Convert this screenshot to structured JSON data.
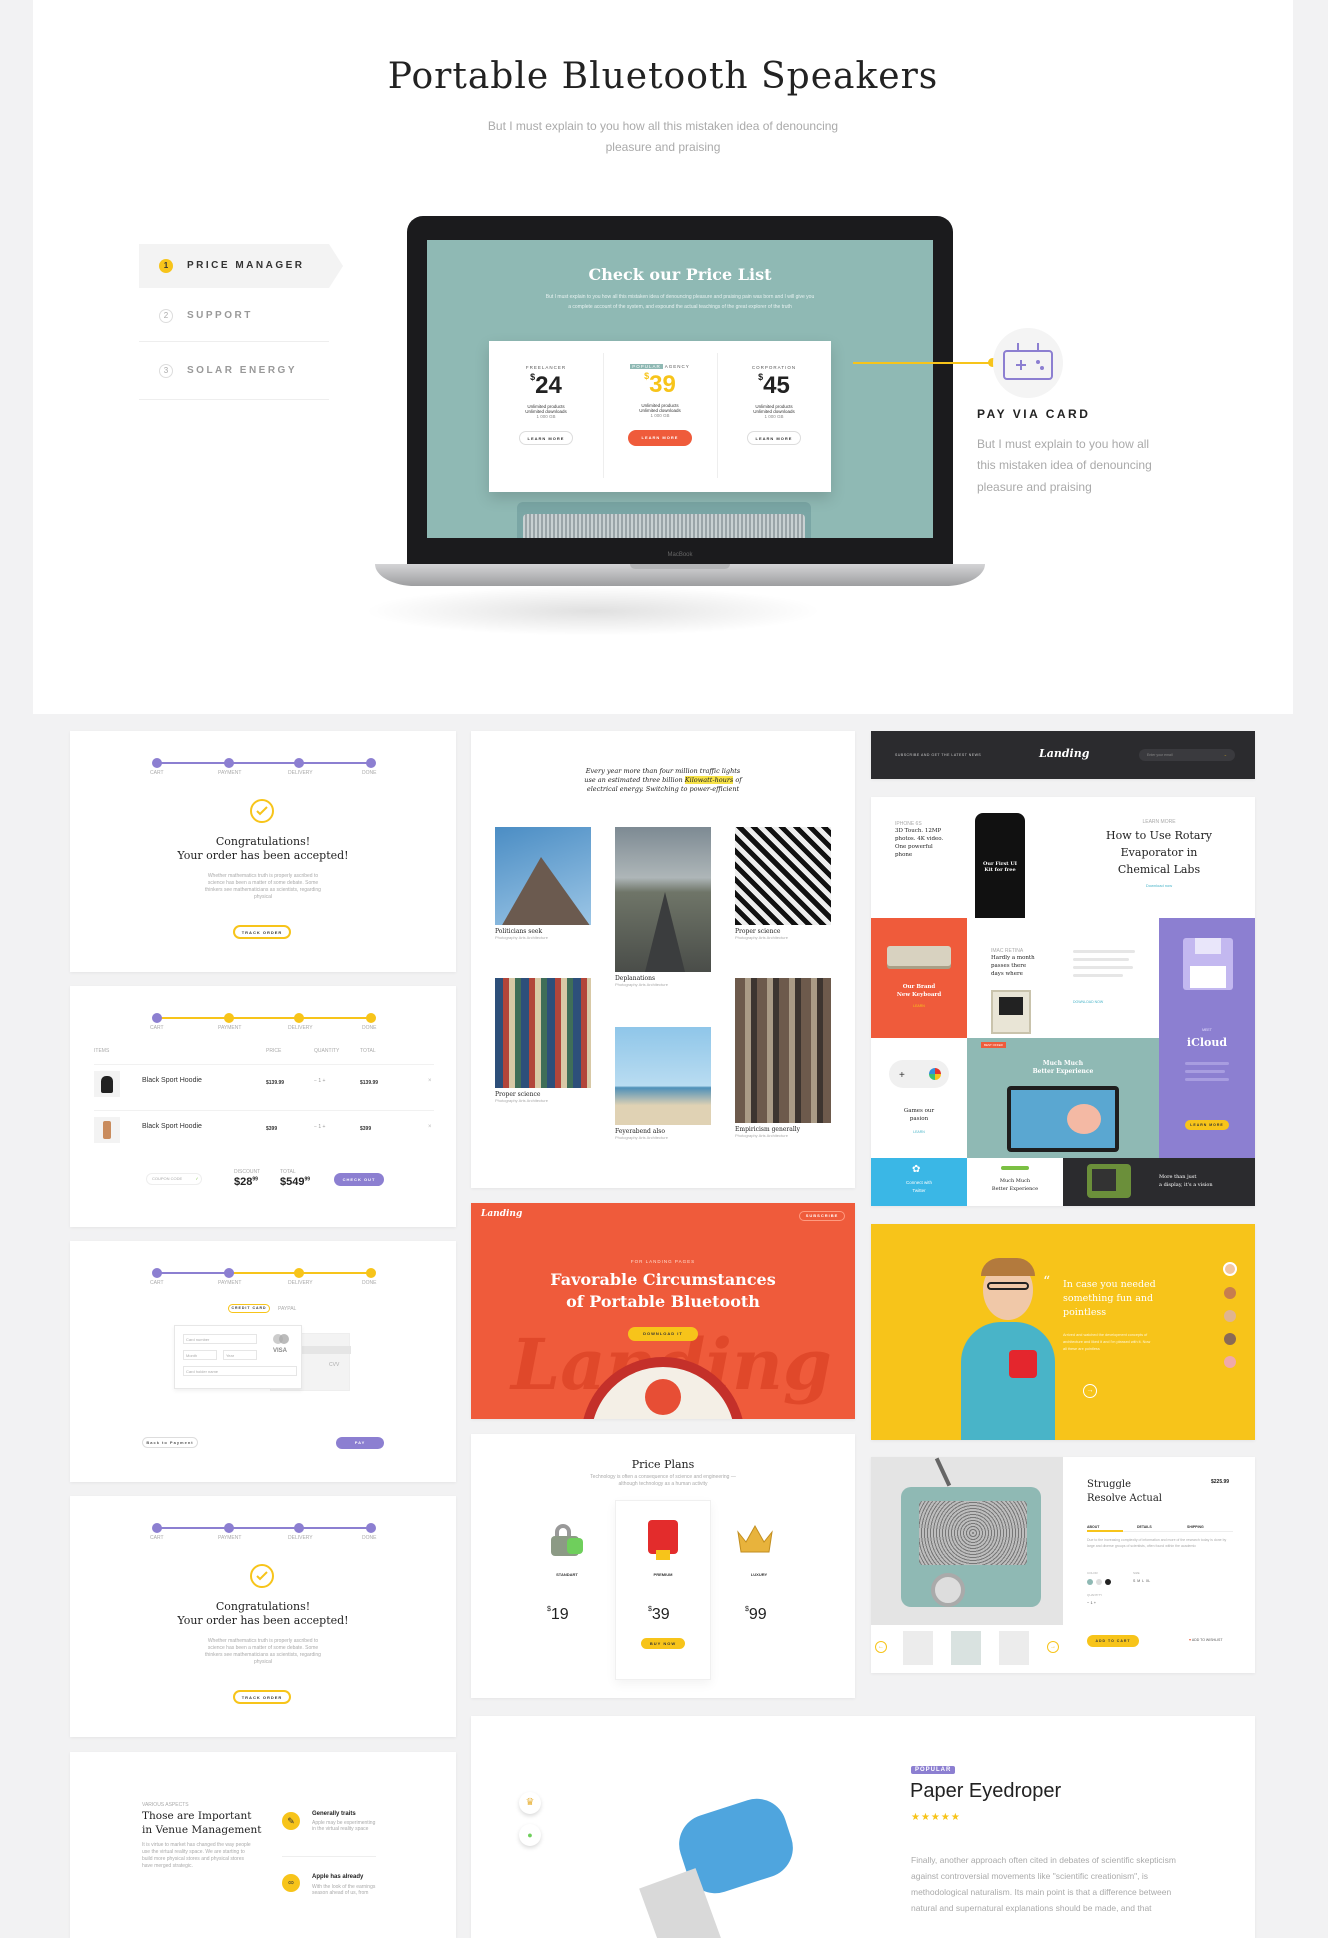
{
  "hero": {
    "title": "Portable Bluetooth Speakers",
    "subtitle_line1": "But I must explain to you how all this mistaken idea of denouncing",
    "subtitle_line2": "pleasure and praising",
    "tabs": [
      {
        "num": "1",
        "label": "PRICE MANAGER"
      },
      {
        "num": "2",
        "label": "SUPPORT"
      },
      {
        "num": "3",
        "label": "SOLAR ENERGY"
      }
    ],
    "laptop": {
      "heading": "Check our Price List",
      "text": "But I must explain to you how all this mistaken idea of denouncing pleasure and praising pain was born and I will give you a complete account of the system, and expound the actual teachings of the great explorer of the truth",
      "brand": "MacBook",
      "plans": [
        {
          "name": "FREELANCER",
          "badge": "",
          "price": "24",
          "features": [
            "Unlimited products",
            "Unlimited downloads",
            "1 000 GB"
          ],
          "cta": "LEARN MORE"
        },
        {
          "name": "AGENCY",
          "badge": "POPULAR",
          "price": "39",
          "features": [
            "Unlimited products",
            "Unlimited downloads",
            "1 000 GB"
          ],
          "cta": "LEARN MORE"
        },
        {
          "name": "CORPORATION",
          "badge": "",
          "price": "45",
          "features": [
            "Unlimited products",
            "Unlimited downloads",
            "1 000 GB"
          ],
          "cta": "LEARN MORE"
        }
      ]
    },
    "feature": {
      "title": "PAY VIA CARD",
      "text1": "But I must explain to you how all",
      "text2": "this mistaken idea of denouncing",
      "text3": "pleasure and praising",
      "icon": "gamepad-icon"
    }
  },
  "steps": [
    "CART",
    "PAYMENT",
    "DELIVERY",
    "DONE"
  ],
  "confirm": {
    "title1": "Congratulations!",
    "title2": "Your order has been accepted!",
    "text": "Whether mathematics truth is properly ascribed to science has been a matter of some debate. Some thinkers see mathematicians as scientists, regarding physical",
    "button": "TRACK ORDER"
  },
  "cart": {
    "headers": [
      "ITEMS",
      "PRICE",
      "QUANTITY",
      "TOTAL"
    ],
    "rows": [
      {
        "name": "Black Sport Hoodie",
        "price": "$139.99",
        "qty": "1",
        "total": "$139.99"
      },
      {
        "name": "Black Sport Hoodie",
        "price": "$399",
        "qty": "1",
        "total": "$399"
      }
    ],
    "coupon": "COUPON CODE",
    "discount_label": "DISCOUNT",
    "discount": "$28",
    "discount_cents": "99",
    "total_label": "TOTAL",
    "total": "$549",
    "total_cents": "99",
    "checkout": "CHECK OUT"
  },
  "payment": {
    "tab_card": "CREDIT CARD",
    "tab_paypal": "PAYPAL",
    "card_number": "Card number",
    "month": "Month",
    "year": "Year",
    "card_name": "Card holder name",
    "brand": "VISA",
    "cvv": "CVV",
    "back": "Back to Payment",
    "pay": "PAY"
  },
  "venue": {
    "eyebrow": "VARIOUS ASPECTS",
    "title1": "Those are Important",
    "title2": "in Venue Management",
    "text": "It is virtue to market has changed the way people use the virtual reality space. We are starting to build more physical stores and physical stores have merged strategic.",
    "item1_title": "Generally traits",
    "item1_text": "Apple may be experimenting in the virtual reality space",
    "item2_title": "Apple has already",
    "item2_text": "With the look of the earnings season ahead of us, from"
  },
  "gallery": {
    "quote_line1": "Every year more than four million traffic lights",
    "quote_line2_a": "use an estimated three billion",
    "quote_highlight": "Kilowatt-hours",
    "quote_line2_b": "of",
    "quote_line3": "electrical energy. Switching to power-efficient",
    "items": [
      {
        "title": "Politicians seek",
        "tags": "Photography  Arts  Architecture"
      },
      {
        "title": "Deplanations",
        "tags": "Photography  Arts  Architecture"
      },
      {
        "title": "Proper science",
        "tags": "Photography  Arts  Architecture"
      },
      {
        "title": "Proper science",
        "tags": "Photography  Arts  Architecture"
      },
      {
        "title": "Feyerabend also",
        "tags": "Photography  Arts  Architecture"
      },
      {
        "title": "Empiricism generally",
        "tags": "Photography  Arts  Architecture"
      }
    ]
  },
  "hero_orange": {
    "logo": "Landing",
    "subscribe": "SUBSCRIBE",
    "eyebrow": "FOR LANDING PAGES",
    "title1": "Favorable Circumstances",
    "title2": "of Portable Bluetooth",
    "button": "DOWNLOAD IT",
    "watermark": "Landing"
  },
  "price_plans": {
    "title": "Price Plans",
    "subtitle": "Technology is often a consequence of science and engineering — although technology as a human activity",
    "plans": [
      {
        "name": "STANDART",
        "price": "19"
      },
      {
        "name": "PREMIUM",
        "price": "39",
        "cta": "BUY NOW"
      },
      {
        "name": "LUXURY",
        "price": "99"
      }
    ]
  },
  "newsletter": {
    "text": "SUBSCRIBE AND GET THE LATEST NEWS",
    "logo": "Landing",
    "placeholder": "Enter your email"
  },
  "mosaic": {
    "phone_eyebrow": "IPHONE 6S",
    "phone_text1": "3D Touch. 12MP",
    "phone_text2": "photos. 4K video.",
    "phone_text3": "One powerful",
    "phone_text4": "phone",
    "phone_screen": "Our First UI Kit for free",
    "article_eyebrow": "LEARN MORE",
    "article_title1": "How to Use Rotary",
    "article_title2": "Evaporator in",
    "article_title3": "Chemical Labs",
    "article_link": "Download now",
    "keyboard_title1": "Our Brand",
    "keyboard_title2": "New Keyboard",
    "keyboard_link": "LEARN",
    "imac_eyebrow": "IMAC RETINA",
    "imac_text1": "Hardly a month",
    "imac_text2": "passes there",
    "imac_text3": "days where",
    "imac_link": "DOWNLOAD NOW",
    "icloud_eyebrow": "MEET",
    "icloud_title": "iCloud",
    "icloud_btn": "LEARN MORE",
    "gamepad_title1": "Games our",
    "gamepad_title2": "pasion",
    "gamepad_link": "LEARN",
    "center_badge": "BEST OFFER",
    "center_title1": "Much Much",
    "center_title2": "Better Experience",
    "twitter_title1": "Connect with",
    "twitter_title2": "Twitter",
    "much_title1": "Much Much",
    "much_title2": "Better Experience",
    "tv_title1": "More than just",
    "tv_title2": "a display, it's a vision"
  },
  "testimonial": {
    "quote1": "In case you needed",
    "quote2": "something fun and",
    "quote3": "pointless",
    "text": "Arrived and watched the development concepts of architecture and liked it and I'm pleased with it. Now all these are pointless"
  },
  "product": {
    "title1": "Struggle",
    "title2": "Resolve Actual",
    "price": "$225.99",
    "tabs": [
      "ABOUT",
      "DETAILS",
      "SHIPPING"
    ],
    "text": "Due to the increasing complexity of information and more of the research today is done by large and diverse groups of scientists, often found within the academic",
    "color_label": "COLOR",
    "size_label": "SIZE",
    "qty_label": "QUANTITY",
    "qty": "1",
    "cart_btn": "ADD TO CART",
    "wishlist": "ADD TO WISHLIST"
  },
  "feature_product": {
    "badge": "POPULAR",
    "title": "Paper Eyedroper",
    "stars": "★★★★★",
    "text1": "Finally, another approach often cited in debates of scientific skepticism",
    "text2": "against controversial movements like \"scientific creationism\", is",
    "text3": "methodological naturalism. Its main point is that a difference between",
    "text4": "natural and supernatural explanations should be made, and that"
  }
}
